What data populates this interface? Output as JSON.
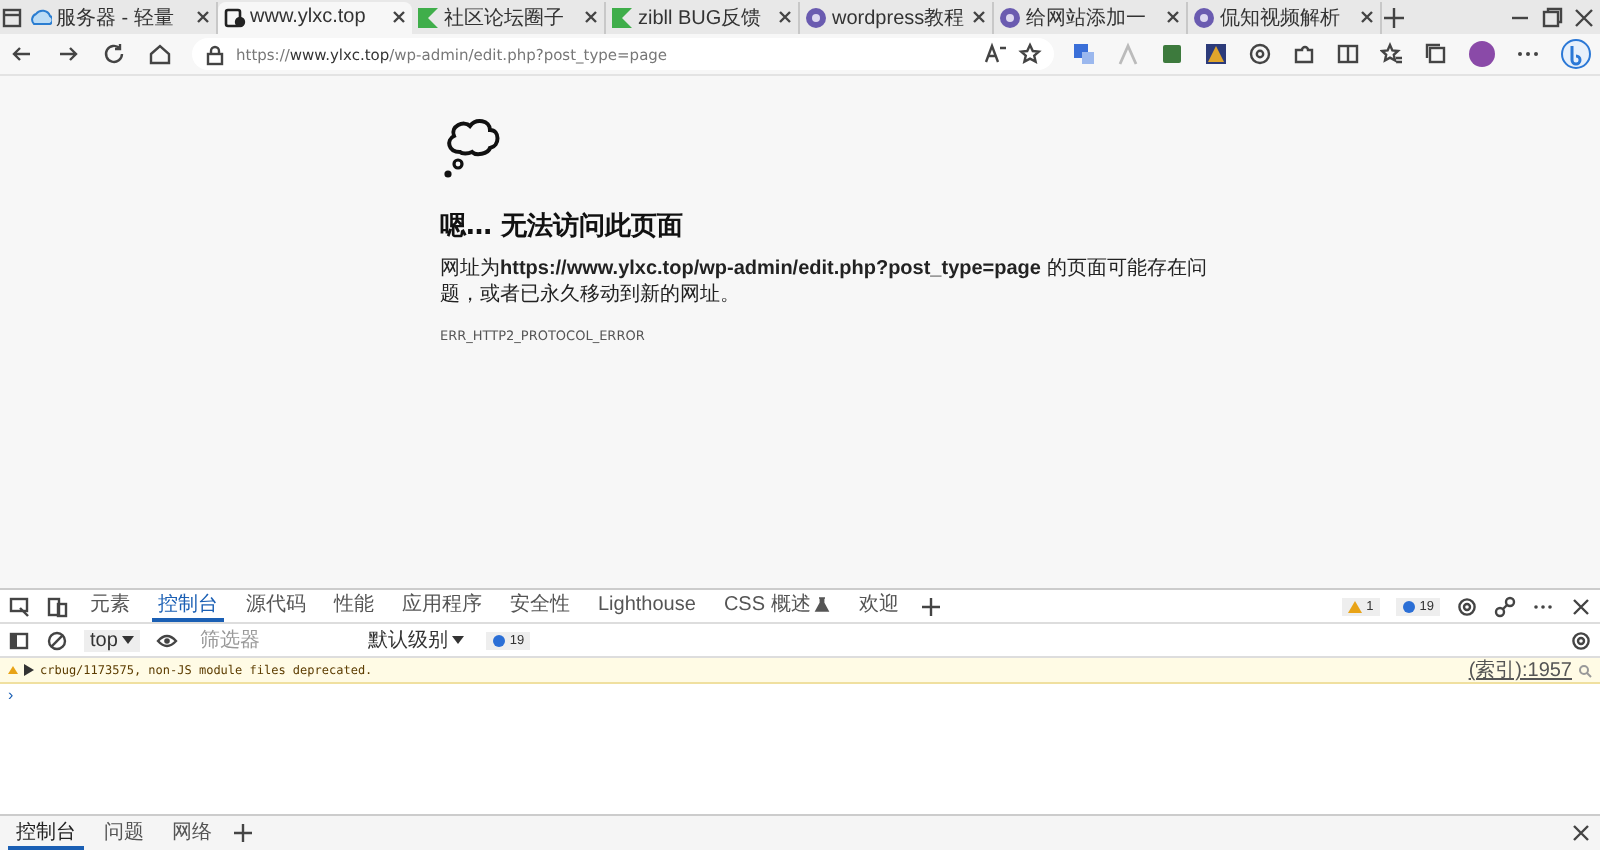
{
  "browser_tabs": [
    {
      "title": "服务器 - 轻量",
      "selected": false
    },
    {
      "title": "www.ylxc.top",
      "selected": true
    },
    {
      "title": "社区论坛圈子",
      "selected": false
    },
    {
      "title": "zibll BUG反馈",
      "selected": false
    },
    {
      "title": "wordpress教程",
      "selected": false
    },
    {
      "title": "给网站添加一",
      "selected": false
    },
    {
      "title": "侃知视频解析",
      "selected": false
    }
  ],
  "address_bar": {
    "url": "https://**www.ylxc.top**/wp-admin/edit.php?post_type=page"
  },
  "error_page": {
    "title": "嗯… 无法访问此页面",
    "message": "网址为**https://www.ylxc.top/wp-admin/edit.php?post_type=page** 的页面可能存在问题，或者已永久移动到新的网址。",
    "code": "ERR_HTTP2_PROTOCOL_ERROR"
  },
  "devtools": {
    "tabs": [
      {
        "label": "元素",
        "selected": false
      },
      {
        "label": "控制台",
        "selected": true
      },
      {
        "label": "源代码",
        "selected": false
      },
      {
        "label": "性能",
        "selected": false
      },
      {
        "label": "应用程序",
        "selected": false
      },
      {
        "label": "安全性",
        "selected": false
      },
      {
        "label": "Lighthouse",
        "selected": false
      },
      {
        "label": "CSS 概述",
        "selected": false,
        "flask": true
      },
      {
        "label": "欢迎",
        "selected": false
      }
    ],
    "warning_count": "1",
    "info_count": "19",
    "console_toolbar": {
      "context": "top",
      "filter": {
        "placeholder": "筛选器"
      },
      "level": "默认级别",
      "issues": "19"
    },
    "messages": [
      {
        "kind": "warning",
        "text": "crbug/1173575, non-JS module files deprecated.",
        "source": "(索引):1957"
      }
    ],
    "prompt": "›"
  },
  "drawer_tabs": [
    {
      "label": "控制台",
      "selected": true
    },
    {
      "label": "问题",
      "selected": false
    },
    {
      "label": "网络",
      "selected": false
    }
  ]
}
